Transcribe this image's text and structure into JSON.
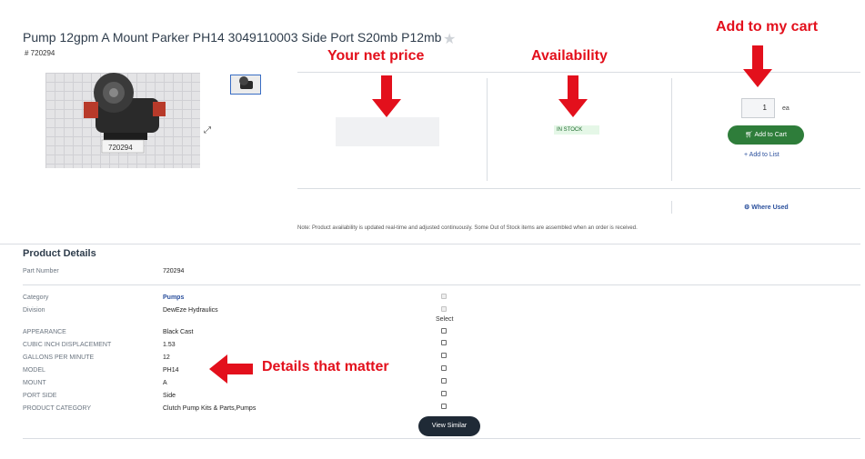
{
  "product": {
    "title": "Pump 12gpm A Mount Parker PH14 3049110003 Side Port S20mb P12mb",
    "sku": "# 720294",
    "image_label": "720294"
  },
  "purchase": {
    "availability": "IN STOCK",
    "quantity": "1",
    "unit": "ea",
    "add_to_cart": "Add to Cart",
    "add_to_list": "Add to List",
    "where_used": "Where Used"
  },
  "note": "Note: Product availability is updated real-time and adjusted continuously. Some Out of Stock items are assembled when an order is received.",
  "details": {
    "section_title": "Product Details",
    "part_number_label": "Part Number",
    "part_number_value": "720294",
    "select_label": "Select",
    "category_rows": [
      {
        "label": "Category",
        "value": "Pumps"
      },
      {
        "label": "Division",
        "value": "DewEze Hydraulics"
      }
    ],
    "attribute_rows": [
      {
        "label": "APPEARANCE",
        "value": "Black Cast"
      },
      {
        "label": "CUBIC INCH DISPLACEMENT",
        "value": "1.53"
      },
      {
        "label": "GALLONS PER MINUTE",
        "value": "12"
      },
      {
        "label": "MODEL",
        "value": "PH14"
      },
      {
        "label": "MOUNT",
        "value": "A"
      },
      {
        "label": "PORT SIDE",
        "value": "Side"
      },
      {
        "label": "PRODUCT CATEGORY",
        "value": "Clutch Pump Kits & Parts,Pumps"
      }
    ],
    "view_similar": "View Similar"
  },
  "annotations": {
    "price": "Your net price",
    "availability": "Availability",
    "cart": "Add to my cart",
    "details": "Details that matter",
    "color": "#e3101c"
  },
  "icons": [
    "star-icon",
    "expand-icon",
    "cart-icon",
    "plus-icon",
    "gear-icon"
  ]
}
